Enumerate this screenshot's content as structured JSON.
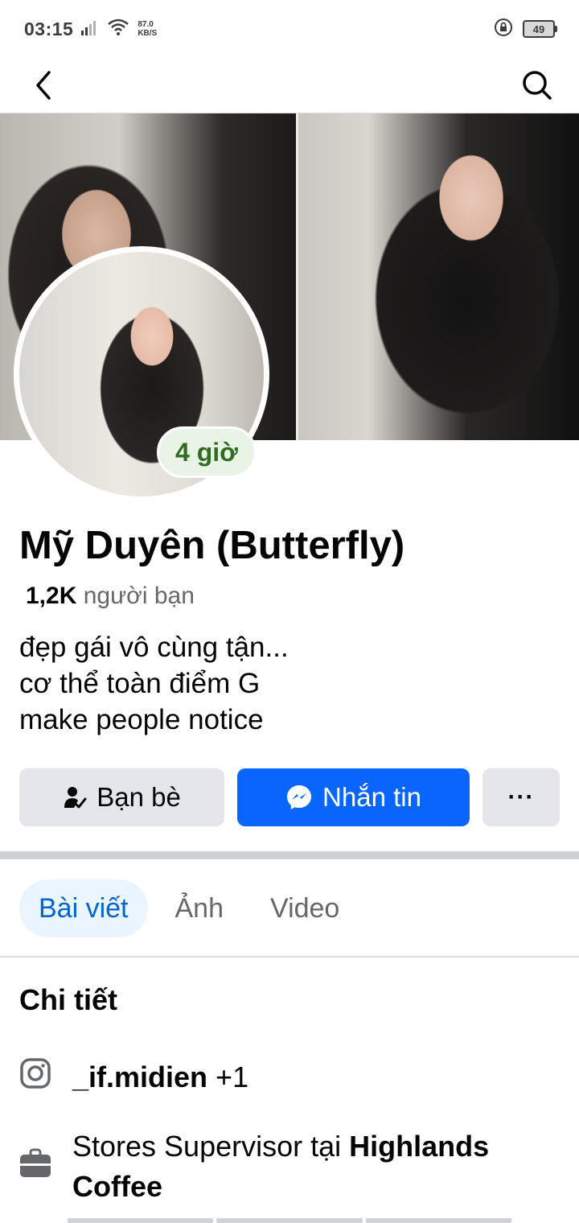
{
  "status_bar": {
    "time": "03:15",
    "net_speed_value": "87.0",
    "net_speed_unit": "KB/S",
    "battery": "49"
  },
  "nav": {
    "back_icon": "chevron-left-icon",
    "search_icon": "search-icon"
  },
  "profile": {
    "story_badge": "4 giờ",
    "name": "Mỹ Duyên (Butterfly)",
    "friends_count": "1,2K",
    "friends_label": "người bạn",
    "bio": [
      "đẹp gái vô cùng tận...",
      "cơ thể toàn điểm G",
      "make people notice"
    ]
  },
  "actions": {
    "friends_label": "Bạn bè",
    "message_label": "Nhắn tin",
    "more_label": "···"
  },
  "tabs": [
    {
      "label": "Bài viết",
      "active": true
    },
    {
      "label": "Ảnh",
      "active": false
    },
    {
      "label": "Video",
      "active": false
    }
  ],
  "details": {
    "title": "Chi tiết",
    "instagram_handle": "_if.midien",
    "instagram_extra": "+1",
    "work_prefix": "Stores Supervisor tại",
    "work_place": "Highlands Coffee"
  },
  "colors": {
    "accent": "#0866ff",
    "tab_active_bg": "#ebf5ff",
    "story_badge_text": "#2f6d23"
  }
}
